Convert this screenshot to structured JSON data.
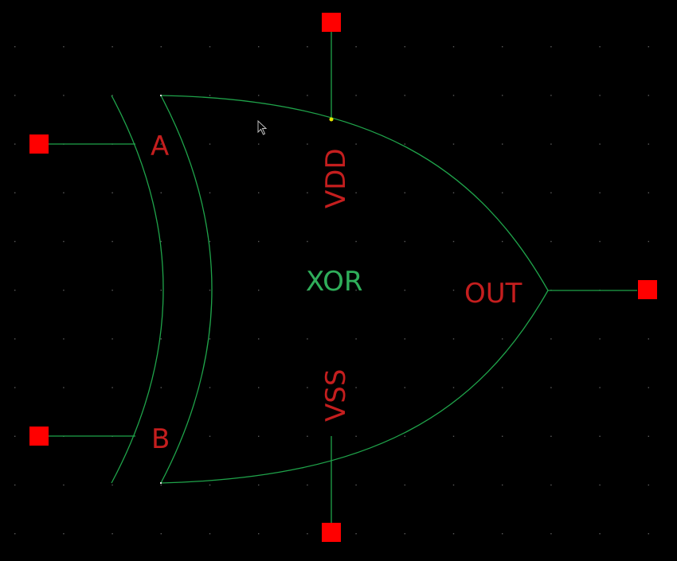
{
  "cell": {
    "name": "XOR"
  },
  "pins": {
    "a": "A",
    "b": "B",
    "vdd": "VDD",
    "vss": "VSS",
    "out": "OUT"
  },
  "colors": {
    "background": "#000000",
    "grid_dot": "#5a5a5a",
    "wire": "#1fa34a",
    "pin_label": "#c41e1e",
    "pin_terminal": "#ff0000",
    "cell_label": "#2fae5a",
    "selection_dot": "#e6e600",
    "cursor": "#bfbfbf"
  },
  "icons": {
    "pointer": "arrow-cursor-icon"
  }
}
